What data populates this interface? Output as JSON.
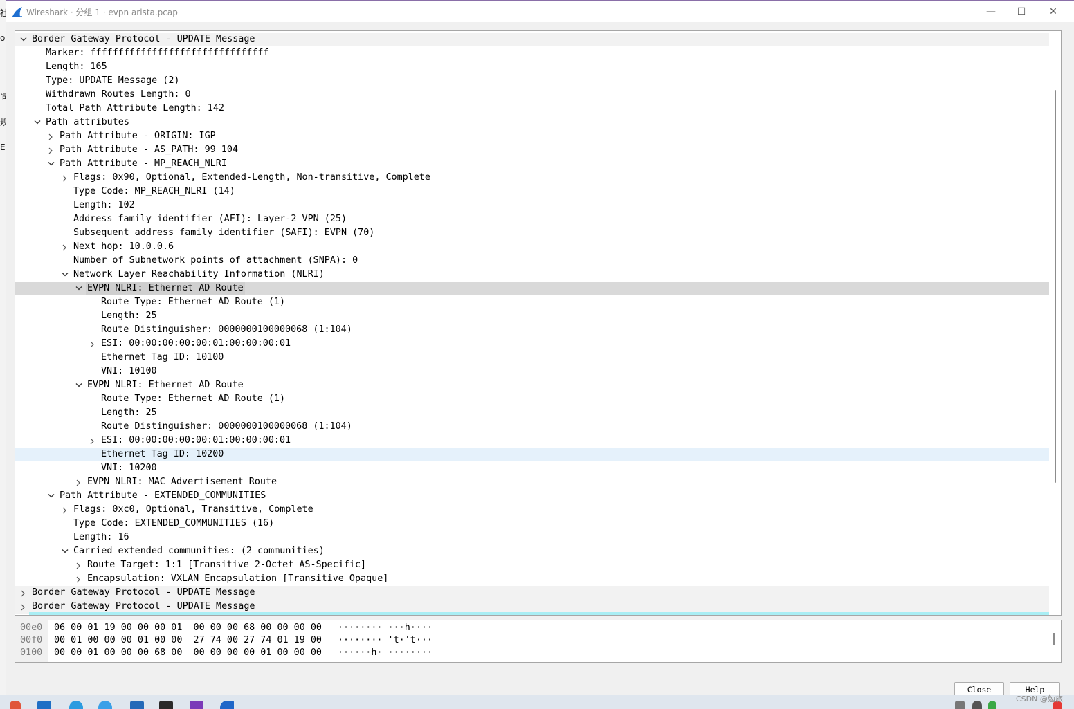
{
  "window": {
    "title": "Wireshark · 分组 1 · evpn arista.pcap",
    "minimize": "—",
    "maximize": "☐",
    "close": "✕"
  },
  "left_strip": [
    "社",
    "o",
    "问",
    "规",
    "E"
  ],
  "tree": [
    {
      "indent": 0,
      "expander": "open",
      "text": "Border Gateway Protocol - UPDATE Message",
      "style": "alt"
    },
    {
      "indent": 1,
      "expander": "none",
      "text": "Marker: ffffffffffffffffffffffffffffffff"
    },
    {
      "indent": 1,
      "expander": "none",
      "text": "Length: 165"
    },
    {
      "indent": 1,
      "expander": "none",
      "text": "Type: UPDATE Message (2)"
    },
    {
      "indent": 1,
      "expander": "none",
      "text": "Withdrawn Routes Length: 0"
    },
    {
      "indent": 1,
      "expander": "none",
      "text": "Total Path Attribute Length: 142"
    },
    {
      "indent": 1,
      "expander": "open",
      "text": "Path attributes"
    },
    {
      "indent": 2,
      "expander": "closed",
      "text": "Path Attribute - ORIGIN: IGP"
    },
    {
      "indent": 2,
      "expander": "closed",
      "text": "Path Attribute - AS_PATH: 99 104"
    },
    {
      "indent": 2,
      "expander": "open",
      "text": "Path Attribute - MP_REACH_NLRI"
    },
    {
      "indent": 3,
      "expander": "closed",
      "text": "Flags: 0x90, Optional, Extended-Length, Non-transitive, Complete"
    },
    {
      "indent": 3,
      "expander": "none",
      "text": "Type Code: MP_REACH_NLRI (14)"
    },
    {
      "indent": 3,
      "expander": "none",
      "text": "Length: 102"
    },
    {
      "indent": 3,
      "expander": "none",
      "text": "Address family identifier (AFI): Layer-2 VPN (25)"
    },
    {
      "indent": 3,
      "expander": "none",
      "text": "Subsequent address family identifier (SAFI): EVPN (70)"
    },
    {
      "indent": 3,
      "expander": "closed",
      "text": "Next hop: 10.0.0.6"
    },
    {
      "indent": 3,
      "expander": "none",
      "text": "Number of Subnetwork points of attachment (SNPA): 0"
    },
    {
      "indent": 3,
      "expander": "open",
      "text": "Network Layer Reachability Information (NLRI)"
    },
    {
      "indent": 4,
      "expander": "open",
      "text": "EVPN NLRI: Ethernet AD Route",
      "style": "sel"
    },
    {
      "indent": 5,
      "expander": "none",
      "text": "Route Type: Ethernet AD Route (1)"
    },
    {
      "indent": 5,
      "expander": "none",
      "text": "Length: 25"
    },
    {
      "indent": 5,
      "expander": "none",
      "text": "Route Distinguisher: 0000000100000068 (1:104)"
    },
    {
      "indent": 5,
      "expander": "closed",
      "text": "ESI: 00:00:00:00:00:01:00:00:00:01"
    },
    {
      "indent": 5,
      "expander": "none",
      "text": "Ethernet Tag ID: 10100"
    },
    {
      "indent": 5,
      "expander": "none",
      "text": "VNI: 10100"
    },
    {
      "indent": 4,
      "expander": "open",
      "text": "EVPN NLRI: Ethernet AD Route"
    },
    {
      "indent": 5,
      "expander": "none",
      "text": "Route Type: Ethernet AD Route (1)"
    },
    {
      "indent": 5,
      "expander": "none",
      "text": "Length: 25"
    },
    {
      "indent": 5,
      "expander": "none",
      "text": "Route Distinguisher: 0000000100000068 (1:104)"
    },
    {
      "indent": 5,
      "expander": "closed",
      "text": "ESI: 00:00:00:00:00:01:00:00:00:01"
    },
    {
      "indent": 5,
      "expander": "none",
      "text": "Ethernet Tag ID: 10200",
      "style": "hov"
    },
    {
      "indent": 5,
      "expander": "none",
      "text": "VNI: 10200"
    },
    {
      "indent": 4,
      "expander": "closed",
      "text": "EVPN NLRI: MAC Advertisement Route"
    },
    {
      "indent": 2,
      "expander": "open",
      "text": "Path Attribute - EXTENDED_COMMUNITIES"
    },
    {
      "indent": 3,
      "expander": "closed",
      "text": "Flags: 0xc0, Optional, Transitive, Complete"
    },
    {
      "indent": 3,
      "expander": "none",
      "text": "Type Code: EXTENDED_COMMUNITIES (16)"
    },
    {
      "indent": 3,
      "expander": "none",
      "text": "Length: 16"
    },
    {
      "indent": 3,
      "expander": "open",
      "text": "Carried extended communities: (2 communities)"
    },
    {
      "indent": 4,
      "expander": "closed",
      "text": "Route Target: 1:1 [Transitive 2-Octet AS-Specific]"
    },
    {
      "indent": 4,
      "expander": "closed",
      "text": "Encapsulation: VXLAN Encapsulation [Transitive Opaque]"
    },
    {
      "indent": 0,
      "expander": "closed",
      "text": "Border Gateway Protocol - UPDATE Message",
      "style": "tail"
    },
    {
      "indent": 0,
      "expander": "closed",
      "text": "Border Gateway Protocol - UPDATE Message",
      "style": "tail"
    }
  ],
  "hex": [
    {
      "offset": "00e0",
      "bytes": "06 00 01 19 00 00 00 01  00 00 00 68 00 00 00 00",
      "ascii": "········ ···h····"
    },
    {
      "offset": "00f0",
      "bytes": "00 01 00 00 00 01 00 00  27 74 00 27 74 01 19 00",
      "ascii": "········ 't·'t···"
    },
    {
      "offset": "0100",
      "bytes": "00 00 01 00 00 00 68 00  00 00 00 00 01 00 00 00",
      "ascii": "······h· ········"
    }
  ],
  "buttons": {
    "close": "Close",
    "help": "Help"
  },
  "watermark": "CSDN @勉旅",
  "colors": {
    "selected_row": "#d9d9d9",
    "hover_row": "#e5f1fb",
    "alt_row": "#f2f2f2",
    "accent": "#8a6fa8"
  }
}
